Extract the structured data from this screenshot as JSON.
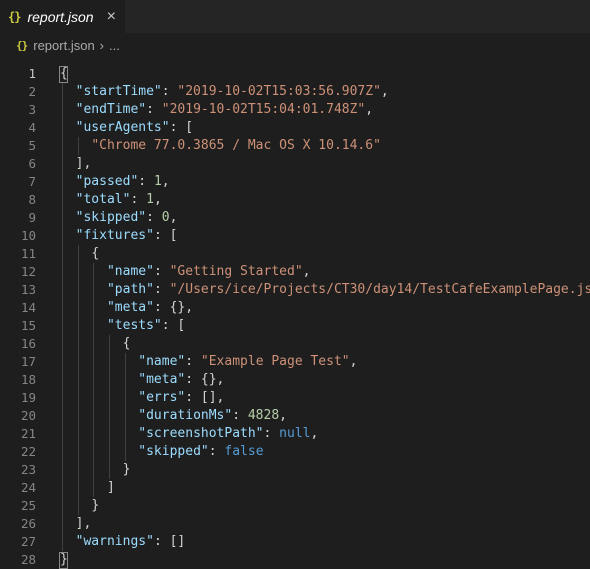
{
  "tab": {
    "icon": "{}",
    "icon_name": "json-file-icon",
    "label": "report.json",
    "close_icon": "×"
  },
  "breadcrumb": {
    "icon": "{}",
    "file": "report.json",
    "separator": "›",
    "ellipsis": "..."
  },
  "lines": [
    {
      "n": "1",
      "t": [
        [
          "p",
          "{"
        ]
      ]
    },
    {
      "n": "2",
      "t": [
        [
          "k",
          "\"startTime\""
        ],
        [
          "p",
          ": "
        ],
        [
          "s",
          "\"2019-10-02T15:03:56.907Z\""
        ],
        [
          "p",
          ","
        ]
      ]
    },
    {
      "n": "3",
      "t": [
        [
          "k",
          "\"endTime\""
        ],
        [
          "p",
          ": "
        ],
        [
          "s",
          "\"2019-10-02T15:04:01.748Z\""
        ],
        [
          "p",
          ","
        ]
      ]
    },
    {
      "n": "4",
      "t": [
        [
          "k",
          "\"userAgents\""
        ],
        [
          "p",
          ": ["
        ]
      ]
    },
    {
      "n": "5",
      "t": [
        [
          "s",
          "\"Chrome 77.0.3865 / Mac OS X 10.14.6\""
        ]
      ]
    },
    {
      "n": "6",
      "t": [
        [
          "p",
          "],"
        ]
      ]
    },
    {
      "n": "7",
      "t": [
        [
          "k",
          "\"passed\""
        ],
        [
          "p",
          ": "
        ],
        [
          "n",
          "1"
        ],
        [
          "p",
          ","
        ]
      ]
    },
    {
      "n": "8",
      "t": [
        [
          "k",
          "\"total\""
        ],
        [
          "p",
          ": "
        ],
        [
          "n",
          "1"
        ],
        [
          "p",
          ","
        ]
      ]
    },
    {
      "n": "9",
      "t": [
        [
          "k",
          "\"skipped\""
        ],
        [
          "p",
          ": "
        ],
        [
          "n",
          "0"
        ],
        [
          "p",
          ","
        ]
      ]
    },
    {
      "n": "10",
      "t": [
        [
          "k",
          "\"fixtures\""
        ],
        [
          "p",
          ": ["
        ]
      ]
    },
    {
      "n": "11",
      "t": [
        [
          "p",
          "{"
        ]
      ]
    },
    {
      "n": "12",
      "t": [
        [
          "k",
          "\"name\""
        ],
        [
          "p",
          ": "
        ],
        [
          "s",
          "\"Getting Started\""
        ],
        [
          "p",
          ","
        ]
      ]
    },
    {
      "n": "13",
      "t": [
        [
          "k",
          "\"path\""
        ],
        [
          "p",
          ": "
        ],
        [
          "s",
          "\"/Users/ice/Projects/CT30/day14/TestCafeExamplePage.js\""
        ],
        [
          "p",
          ","
        ]
      ]
    },
    {
      "n": "14",
      "t": [
        [
          "k",
          "\"meta\""
        ],
        [
          "p",
          ": {},"
        ]
      ]
    },
    {
      "n": "15",
      "t": [
        [
          "k",
          "\"tests\""
        ],
        [
          "p",
          ": ["
        ]
      ]
    },
    {
      "n": "16",
      "t": [
        [
          "p",
          "{"
        ]
      ]
    },
    {
      "n": "17",
      "t": [
        [
          "k",
          "\"name\""
        ],
        [
          "p",
          ": "
        ],
        [
          "s",
          "\"Example Page Test\""
        ],
        [
          "p",
          ","
        ]
      ]
    },
    {
      "n": "18",
      "t": [
        [
          "k",
          "\"meta\""
        ],
        [
          "p",
          ": {},"
        ]
      ]
    },
    {
      "n": "19",
      "t": [
        [
          "k",
          "\"errs\""
        ],
        [
          "p",
          ": [],"
        ]
      ]
    },
    {
      "n": "20",
      "t": [
        [
          "k",
          "\"durationMs\""
        ],
        [
          "p",
          ": "
        ],
        [
          "n",
          "4828"
        ],
        [
          "p",
          ","
        ]
      ]
    },
    {
      "n": "21",
      "t": [
        [
          "k",
          "\"screenshotPath\""
        ],
        [
          "p",
          ": "
        ],
        [
          "kw",
          "null"
        ],
        [
          "p",
          ","
        ]
      ]
    },
    {
      "n": "22",
      "t": [
        [
          "k",
          "\"skipped\""
        ],
        [
          "p",
          ": "
        ],
        [
          "kw",
          "false"
        ]
      ]
    },
    {
      "n": "23",
      "t": [
        [
          "p",
          "}"
        ]
      ]
    },
    {
      "n": "24",
      "t": [
        [
          "p",
          "]"
        ]
      ]
    },
    {
      "n": "25",
      "t": [
        [
          "p",
          "}"
        ]
      ]
    },
    {
      "n": "26",
      "t": [
        [
          "p",
          "],"
        ]
      ]
    },
    {
      "n": "27",
      "t": [
        [
          "k",
          "\"warnings\""
        ],
        [
          "p",
          ": []"
        ]
      ]
    },
    {
      "n": "28",
      "t": [
        [
          "p",
          "}"
        ]
      ]
    }
  ]
}
